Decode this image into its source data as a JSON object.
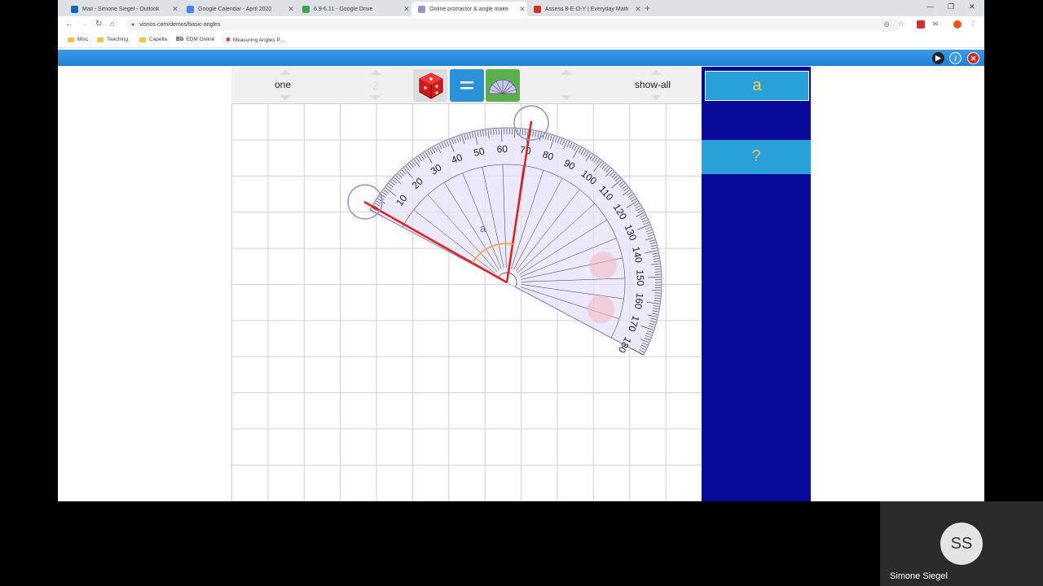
{
  "tabs": [
    {
      "label": "Mail - Simone Siegel - Outlook",
      "color": "#0f6cbd",
      "active": false
    },
    {
      "label": "Google Calendar - April 2020",
      "color": "#4285f4",
      "active": false
    },
    {
      "label": "6.9-6.11 - Google Drive",
      "color": "#34a853",
      "active": false
    },
    {
      "label": "Online protractor & angle make",
      "color": "#a48bd0",
      "active": true
    },
    {
      "label": "Assess 8-E-O-Y | Everyday Math",
      "color": "#d93025",
      "active": false
    }
  ],
  "address_bar": {
    "url": "visnos.com/demos/basic-angles"
  },
  "bookmarks": [
    {
      "label": "Misc",
      "type": "folder"
    },
    {
      "label": "Teaching",
      "type": "folder"
    },
    {
      "label": "Capella",
      "type": "folder"
    },
    {
      "label": "EDM Online",
      "type": "bb",
      "mark": "Bb"
    },
    {
      "label": "Measuring Angles P...",
      "type": "link"
    }
  ],
  "app": {
    "controls": {
      "left_label": "one",
      "middle_digit": "2",
      "right_label": "show-all"
    },
    "answer_box": "a",
    "question_box": "?",
    "angle_label": "a",
    "accent_colors": {
      "red_arm": "#e02020",
      "arc": "#f0a030",
      "panel": "#0a0a99",
      "box": "#2aa0d8"
    }
  },
  "protractor": {
    "outer_labels": [
      "10",
      "20",
      "30",
      "40",
      "50",
      "60",
      "70",
      "80",
      "90",
      "100",
      "110",
      "120",
      "130",
      "140",
      "150",
      "160",
      "170",
      "180"
    ]
  },
  "participant": {
    "initials": "SS",
    "name": "Simone Siegel"
  }
}
